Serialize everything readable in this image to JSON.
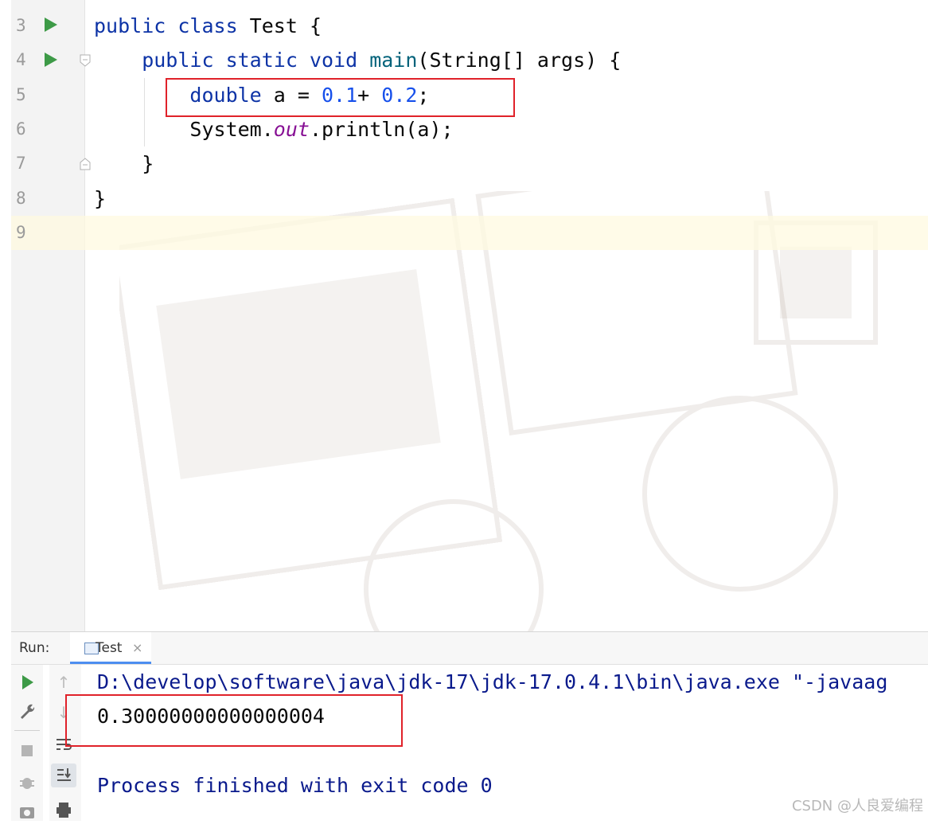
{
  "editor": {
    "line_numbers": [
      "3",
      "4",
      "5",
      "6",
      "7",
      "8",
      "9"
    ],
    "lines": [
      {
        "parts": [
          {
            "t": "public class ",
            "c": "kw"
          },
          {
            "t": "Test ",
            "c": ""
          },
          {
            "t": "{",
            "c": ""
          }
        ]
      },
      {
        "parts": [
          {
            "t": "    public static void ",
            "c": "kw"
          },
          {
            "t": "main",
            "c": "fn"
          },
          {
            "t": "(String[] args) {",
            "c": ""
          }
        ]
      },
      {
        "parts": [
          {
            "t": "        double ",
            "c": "kw"
          },
          {
            "t": "a = ",
            "c": ""
          },
          {
            "t": "0.1",
            "c": "num"
          },
          {
            "t": "+ ",
            "c": ""
          },
          {
            "t": "0.2",
            "c": "num"
          },
          {
            "t": ";",
            "c": ""
          }
        ]
      },
      {
        "parts": [
          {
            "t": "        System.",
            "c": ""
          },
          {
            "t": "out",
            "c": "fld"
          },
          {
            "t": ".println(a);",
            "c": ""
          }
        ]
      },
      {
        "parts": [
          {
            "t": "    }",
            "c": ""
          }
        ]
      },
      {
        "parts": [
          {
            "t": "}",
            "c": ""
          }
        ]
      },
      {
        "parts": []
      }
    ]
  },
  "run_panel": {
    "label": "Run:",
    "tab_label": "Test",
    "tab_close": "×",
    "console_lines": [
      "D:\\develop\\software\\java\\jdk-17\\jdk-17.0.4.1\\bin\\java.exe \"-javaag",
      "0.30000000000000004",
      "",
      "Process finished with exit code 0"
    ]
  },
  "watermark": "CSDN @人良爱编程",
  "colors": {
    "keyword": "#0d33a6",
    "method": "#00627a",
    "number": "#1750eb",
    "field": "#871094",
    "highlight_box": "#e0222a",
    "run_green": "#3d9a47",
    "console_text": "#0a1a8c"
  }
}
